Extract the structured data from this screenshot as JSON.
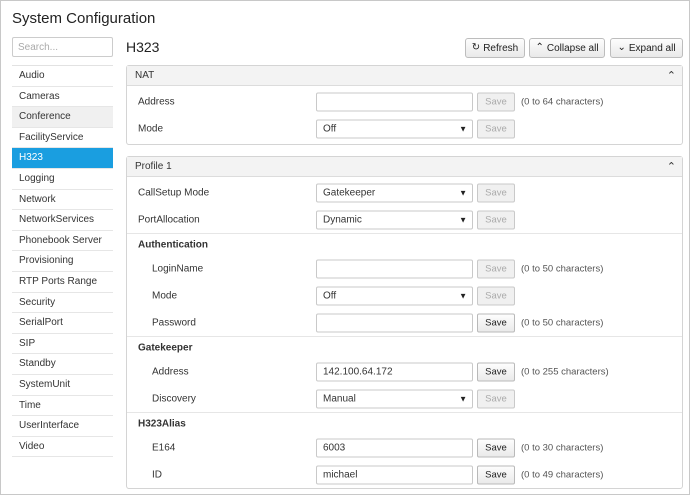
{
  "app": {
    "title": "System Configuration"
  },
  "search": {
    "placeholder": "Search..."
  },
  "sidebar": {
    "items": [
      {
        "label": "Audio"
      },
      {
        "label": "Cameras"
      },
      {
        "label": "Conference"
      },
      {
        "label": "FacilityService"
      },
      {
        "label": "H323"
      },
      {
        "label": "Logging"
      },
      {
        "label": "Network"
      },
      {
        "label": "NetworkServices"
      },
      {
        "label": "Phonebook Server"
      },
      {
        "label": "Provisioning"
      },
      {
        "label": "RTP Ports Range"
      },
      {
        "label": "Security"
      },
      {
        "label": "SerialPort"
      },
      {
        "label": "SIP"
      },
      {
        "label": "Standby"
      },
      {
        "label": "SystemUnit"
      },
      {
        "label": "Time"
      },
      {
        "label": "UserInterface"
      },
      {
        "label": "Video"
      }
    ],
    "active": "H323"
  },
  "header": {
    "title": "H323",
    "refresh_label": "Refresh",
    "collapse_label": "Collapse all",
    "expand_label": "Expand all"
  },
  "nat": {
    "title": "NAT",
    "address": {
      "label": "Address",
      "value": "",
      "save": "Save",
      "hint": "(0 to 64 characters)"
    },
    "mode": {
      "label": "Mode",
      "value": "Off",
      "save": "Save"
    }
  },
  "profile": {
    "title": "Profile 1",
    "callsetup": {
      "label": "CallSetup Mode",
      "value": "Gatekeeper",
      "save": "Save"
    },
    "portalloc": {
      "label": "PortAllocation",
      "value": "Dynamic",
      "save": "Save"
    },
    "authentication": {
      "title": "Authentication",
      "loginname": {
        "label": "LoginName",
        "value": "",
        "save": "Save",
        "hint": "(0 to 50 characters)"
      },
      "mode": {
        "label": "Mode",
        "value": "Off",
        "save": "Save"
      },
      "password": {
        "label": "Password",
        "value": "",
        "save": "Save",
        "hint": "(0 to 50 characters)"
      }
    },
    "gatekeeper": {
      "title": "Gatekeeper",
      "address": {
        "label": "Address",
        "value": "142.100.64.172",
        "save": "Save",
        "hint": "(0 to 255 characters)"
      },
      "discovery": {
        "label": "Discovery",
        "value": "Manual",
        "save": "Save"
      }
    },
    "alias": {
      "title": "H323Alias",
      "e164": {
        "label": "E164",
        "value": "6003",
        "save": "Save",
        "hint": "(0 to 30 characters)"
      },
      "id": {
        "label": "ID",
        "value": "michael",
        "save": "Save",
        "hint": "(0 to 49 characters)"
      }
    }
  },
  "colors": {
    "accent": "#1a9ee0",
    "panel_header": "#f3f3f3",
    "border": "#d4d4d4"
  },
  "icons": {
    "refresh": "refresh-icon",
    "collapse": "chevron-up-icon",
    "expand": "chevron-down-icon"
  }
}
